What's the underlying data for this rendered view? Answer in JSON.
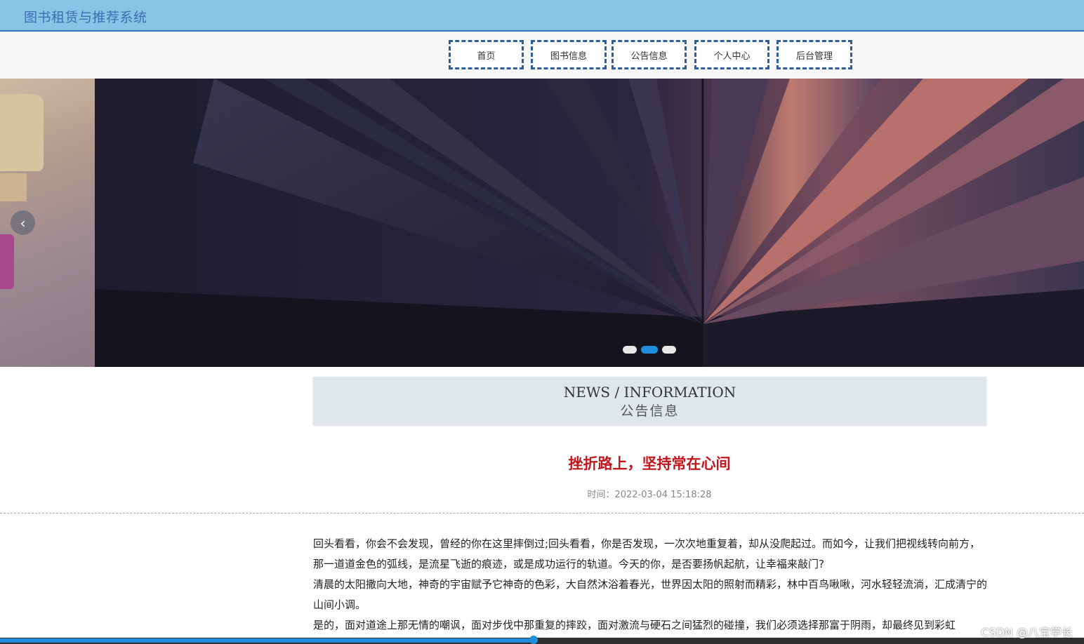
{
  "header": {
    "site_title": "图书租赁与推荐系统"
  },
  "nav": {
    "items": [
      {
        "label": "首页"
      },
      {
        "label": "图书信息"
      },
      {
        "label": "公告信息"
      },
      {
        "label": "个人中心"
      },
      {
        "label": "后台管理"
      }
    ]
  },
  "banner": {
    "prev_arrow": "‹",
    "slide_count": 3,
    "active_slide": 2
  },
  "news": {
    "title_en": "NEWS / INFORMATION",
    "title_cn": "公告信息"
  },
  "article": {
    "title": "挫折路上，坚持常在心间",
    "time": "时间：2022-03-04 15:18:28",
    "paragraphs": [
      "回头看看，你会不会发现，曾经的你在这里摔倒过;回头看看，你是否发现，一次次地重复着，却从没爬起过。而如今，让我们把视线转向前方，那一道道金色的弧线，是流星飞逝的痕迹，或是成功运行的轨道。今天的你，是否要扬帆起航，让幸福来敲门?",
      "清晨的太阳撒向大地，神奇的宇宙赋予它神奇的色彩，大自然沐浴着春光，世界因太阳的照射而精彩，林中百鸟啾啾，河水轻轻流淌，汇成清宁的山间小调。",
      "是的，面对道途上那无情的嘲讽，面对步伐中那重复的摔跤，面对激流与硬石之间猛烈的碰撞，我们必须选择那富于阴雨，却最终见到彩虹"
    ]
  },
  "watermark": "CSDN @八宝学长",
  "colors": {
    "header_bg": "#87c4e6",
    "nav_border": "#2f5f9a",
    "title_red": "#c0171f",
    "accent_blue": "#1f8fdb"
  }
}
